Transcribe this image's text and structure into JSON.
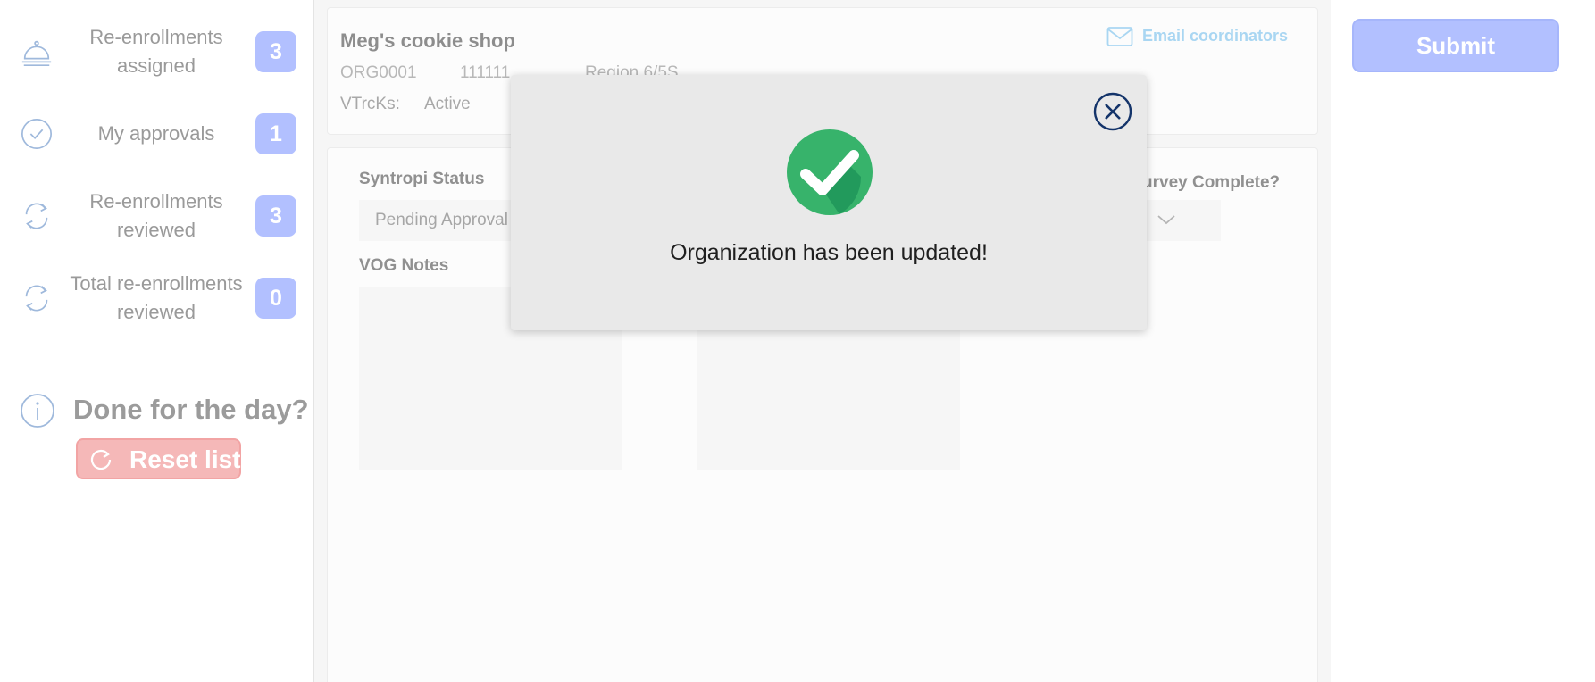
{
  "sidebar": {
    "items": [
      {
        "icon": "bell-icon",
        "label": "Re-enrollments\nassigned",
        "count": "3"
      },
      {
        "icon": "check-circle-icon",
        "label": "My approvals",
        "count": "1"
      },
      {
        "icon": "refresh-icon",
        "label": "Re-enrollments\nreviewed",
        "count": "3"
      },
      {
        "icon": "refresh-icon",
        "label": "Total re-enrollments\nreviewed",
        "count": "0"
      }
    ],
    "done": {
      "title": "Done for the day?",
      "reset_label": "Reset list",
      "icon": "info-icon"
    }
  },
  "org": {
    "name": "Meg's cookie shop",
    "id": "ORG0001",
    "number": "111111",
    "region": "Region 6/5S",
    "vtrcks_label": "VTrcKs:",
    "vtrcks_value": "Active",
    "email_label": "Email coordinators"
  },
  "form": {
    "status_label": "Syntropi Status",
    "status_value": "Pending Approval",
    "notes_label": "VOG Notes",
    "survey_label": "urvey Complete?"
  },
  "actions": {
    "submit_label": "Submit"
  },
  "modal": {
    "message": "Organization has been updated!"
  },
  "colors": {
    "accent": "#b2c0ff",
    "success": "#37b36b",
    "danger": "#f5b8b8",
    "link": "#a9d6f2",
    "navy": "#14346a"
  }
}
